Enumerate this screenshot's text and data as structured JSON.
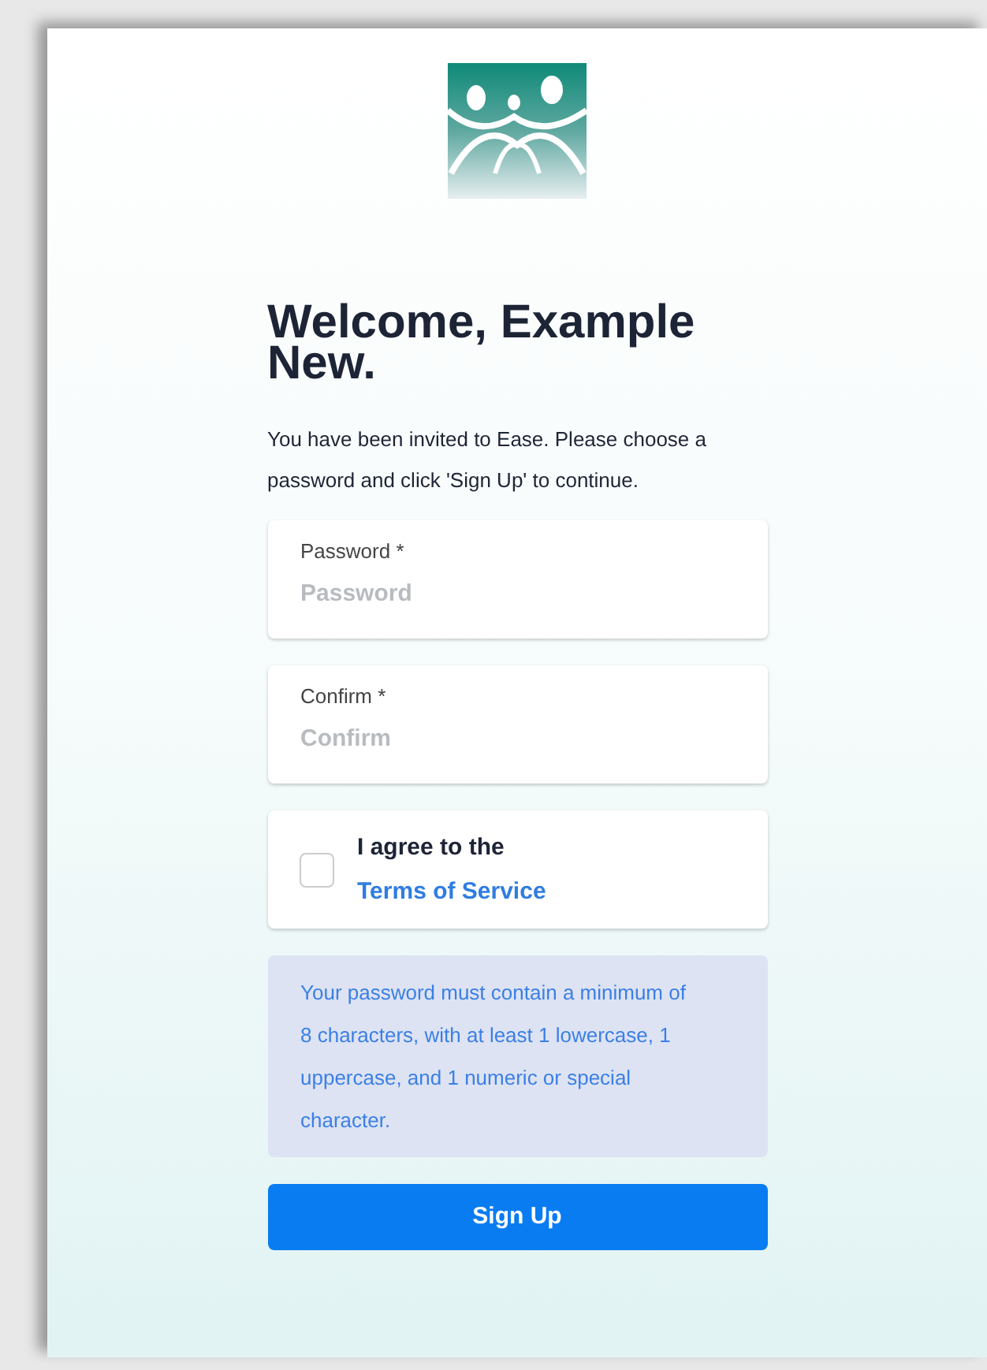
{
  "heading": "Welcome, Example New.",
  "intro": "You have been invited to Ease. Please choose a password and click 'Sign Up' to continue.",
  "fields": [
    {
      "label": "Password *",
      "placeholder": "Password"
    },
    {
      "label": "Confirm *",
      "placeholder": "Confirm"
    }
  ],
  "agreement": {
    "text": "I agree to the",
    "link": "Terms of Service",
    "checked": false
  },
  "notice": "Your password must contain a minimum of 8 characters, with at least 1 lowercase, 1 uppercase, and 1 numeric or special character.",
  "button": "Sign Up"
}
